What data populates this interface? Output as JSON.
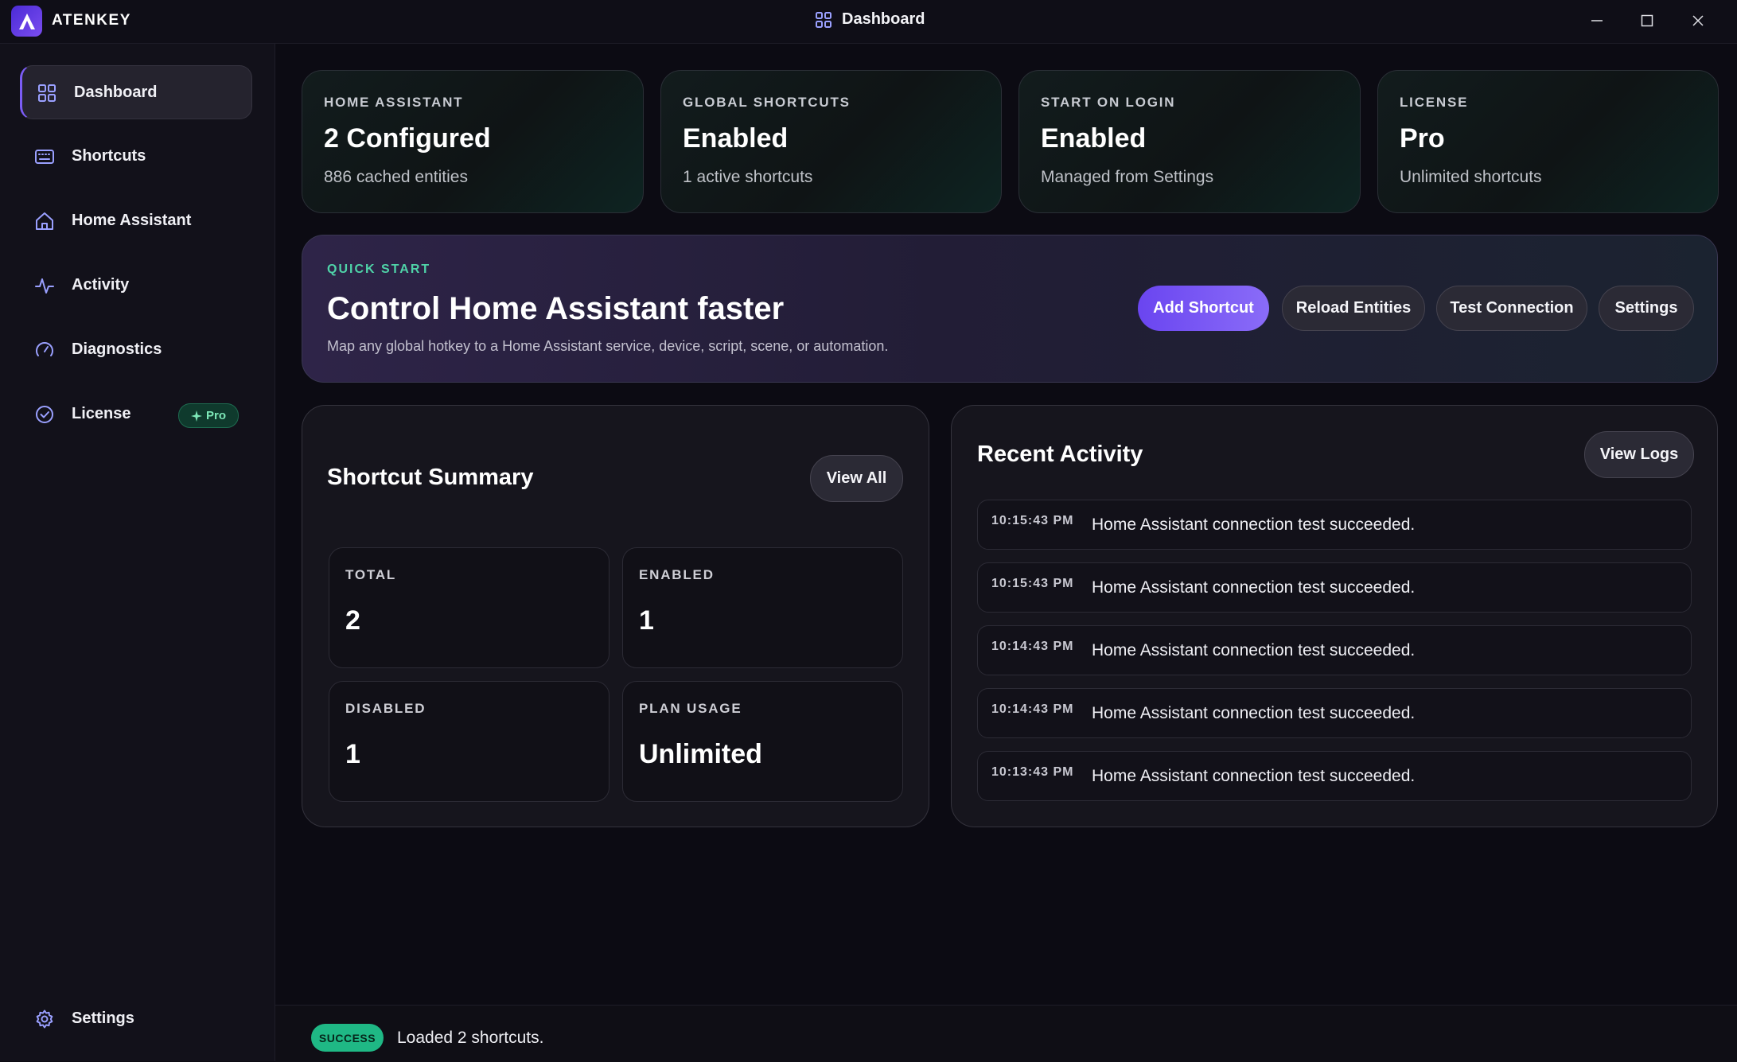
{
  "app": {
    "name": "ATENKEY",
    "window_title": "Dashboard"
  },
  "sidebar": {
    "items": [
      {
        "label": "Dashboard",
        "icon": "dashboard-icon"
      },
      {
        "label": "Shortcuts",
        "icon": "keyboard-icon"
      },
      {
        "label": "Home Assistant",
        "icon": "home-icon"
      },
      {
        "label": "Activity",
        "icon": "activity-icon"
      },
      {
        "label": "Diagnostics",
        "icon": "gauge-icon"
      },
      {
        "label": "License",
        "icon": "check-badge-icon",
        "badge": "Pro"
      }
    ],
    "footer": {
      "label": "Settings",
      "icon": "gear-icon"
    }
  },
  "stats": [
    {
      "label": "HOME ASSISTANT",
      "value": "2 Configured",
      "sub": "886 cached entities"
    },
    {
      "label": "GLOBAL SHORTCUTS",
      "value": "Enabled",
      "sub": "1 active shortcuts"
    },
    {
      "label": "START ON LOGIN",
      "value": "Enabled",
      "sub": "Managed from Settings"
    },
    {
      "label": "LICENSE",
      "value": "Pro",
      "sub": "Unlimited shortcuts"
    }
  ],
  "quick_start": {
    "kicker": "QUICK START",
    "title": "Control Home Assistant faster",
    "description": "Map any global hotkey to a Home Assistant service, device, script, scene, or automation.",
    "buttons": [
      "Add Shortcut",
      "Reload Entities",
      "Test Connection",
      "Settings"
    ]
  },
  "shortcut_summary": {
    "title": "Shortcut Summary",
    "view_all": "View All",
    "tiles": [
      {
        "label": "TOTAL",
        "value": "2"
      },
      {
        "label": "ENABLED",
        "value": "1"
      },
      {
        "label": "DISABLED",
        "value": "1"
      },
      {
        "label": "PLAN USAGE",
        "value": "Unlimited"
      }
    ]
  },
  "recent_activity": {
    "title": "Recent Activity",
    "view_logs": "View Logs",
    "entries": [
      {
        "time": "10:15:43 PM",
        "message": "Home Assistant connection test succeeded."
      },
      {
        "time": "10:15:43 PM",
        "message": "Home Assistant connection test succeeded."
      },
      {
        "time": "10:14:43 PM",
        "message": "Home Assistant connection test succeeded."
      },
      {
        "time": "10:14:43 PM",
        "message": "Home Assistant connection test succeeded."
      },
      {
        "time": "10:13:43 PM",
        "message": "Home Assistant connection test succeeded."
      }
    ]
  },
  "status": {
    "badge": "SUCCESS",
    "message": "Loaded 2 shortcuts."
  },
  "colors": {
    "accent": "#7b5cf5",
    "success": "#1fb885",
    "teal": "#4fd3a8"
  }
}
